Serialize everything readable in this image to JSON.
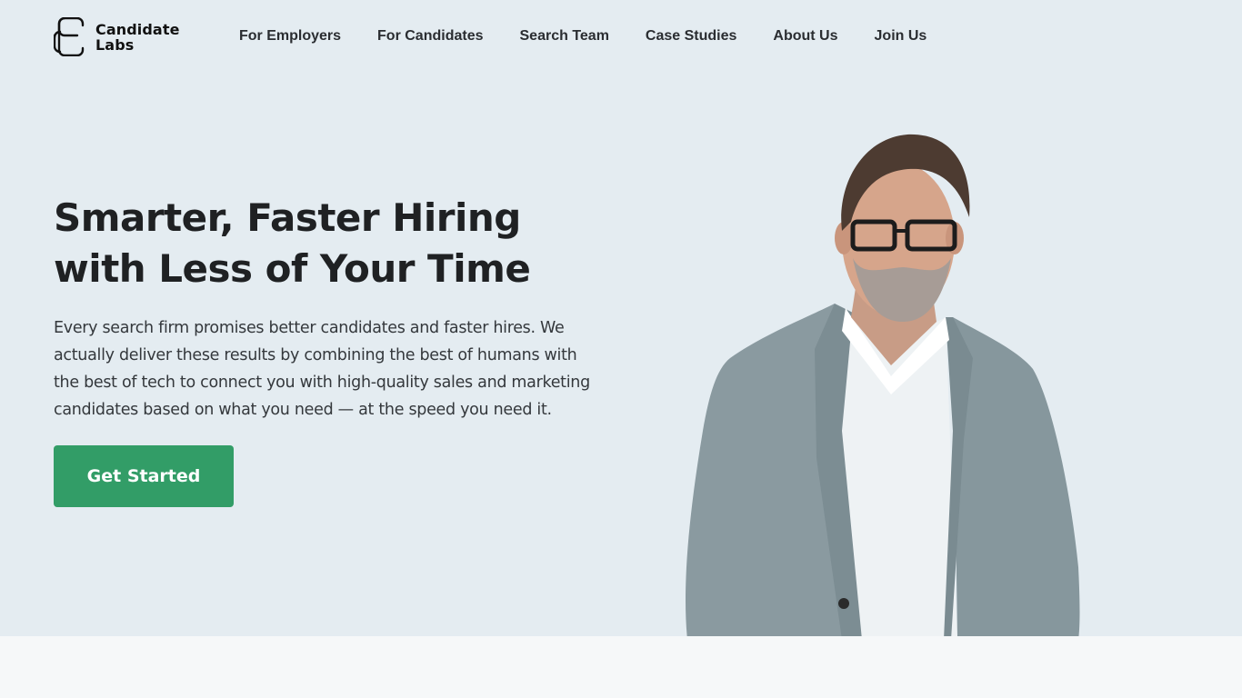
{
  "brand": {
    "name_line1": "Candidate",
    "name_line2": "Labs",
    "logo_icon": "c-monogram-icon"
  },
  "nav": {
    "items": [
      {
        "label": "For Employers"
      },
      {
        "label": "For Candidates"
      },
      {
        "label": "Search Team"
      },
      {
        "label": "Case Studies"
      },
      {
        "label": "About Us"
      },
      {
        "label": "Join Us"
      }
    ]
  },
  "hero": {
    "headline_line1": "Smarter, Faster Hiring",
    "headline_line2": "with Less of Your Time",
    "description": "Every search firm promises better candidates and faster hires. We actually deliver these results by combining the best of humans with the best of tech to connect you with high-quality sales and marketing candidates based on what you need — at the speed you need it.",
    "cta_label": "Get Started",
    "image_alt": "Smiling man with glasses in a grey blazer and white shirt"
  },
  "colors": {
    "hero_background": "#e4ecf1",
    "accent_green": "#329d67",
    "text_dark": "#1f2123",
    "section_background": "#f6f8f9"
  }
}
